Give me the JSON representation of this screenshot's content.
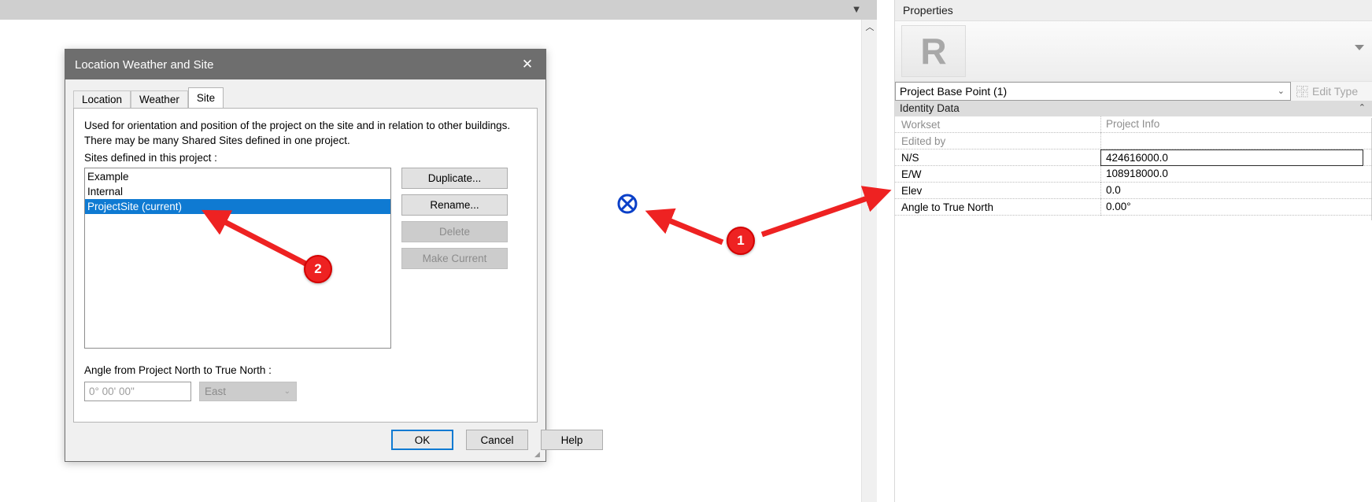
{
  "canvas": {
    "collapse_marker": "▼",
    "scroll_up_arrow": "︿",
    "base_point_name": "project-base-point"
  },
  "annotations": [
    {
      "id": "1",
      "label": "1"
    },
    {
      "id": "2",
      "label": "2"
    }
  ],
  "dialog": {
    "title": "Location Weather and Site",
    "close_glyph": "✕",
    "tabs": [
      {
        "label": "Location",
        "active": false
      },
      {
        "label": "Weather",
        "active": false
      },
      {
        "label": "Site",
        "active": true
      }
    ],
    "description": "Used for orientation and position of the project on the site and in relation to other buildings. There may be many Shared Sites defined in one project.",
    "sites_label": "Sites defined in this project :",
    "sites": [
      {
        "label": "Example",
        "selected": false
      },
      {
        "label": "Internal",
        "selected": false
      },
      {
        "label": "ProjectSite (current)",
        "selected": true
      }
    ],
    "side_buttons": [
      {
        "label": "Duplicate...",
        "disabled": false
      },
      {
        "label": "Rename...",
        "disabled": false
      },
      {
        "label": "Delete",
        "disabled": true
      },
      {
        "label": "Make Current",
        "disabled": true
      }
    ],
    "angle_label": "Angle from Project North to True North :",
    "angle_value": "0° 00' 00\"",
    "angle_direction": "East",
    "angle_direction_chevron": "⌄",
    "footer": {
      "ok": "OK",
      "cancel": "Cancel",
      "help": "Help"
    },
    "resize_grip": "◢"
  },
  "properties": {
    "header_title": "Properties",
    "preview_logo": "R",
    "preview_caret": "caret-down",
    "type_selector": "Project Base Point (1)",
    "type_selector_chevron": "⌄",
    "edit_type_label": "Edit Type",
    "group": {
      "title": "Identity Data",
      "collapse_glyph": "⌃"
    },
    "rows": [
      {
        "name": "Workset",
        "value": "Project Info",
        "readonly": true,
        "active": false
      },
      {
        "name": "Edited by",
        "value": "",
        "readonly": true,
        "active": false
      },
      {
        "name": "N/S",
        "value": "424616000.0",
        "readonly": false,
        "active": true
      },
      {
        "name": "E/W",
        "value": "108918000.0",
        "readonly": false,
        "active": false
      },
      {
        "name": "Elev",
        "value": "0.0",
        "readonly": false,
        "active": false
      },
      {
        "name": "Angle to True North",
        "value": "0.00°",
        "readonly": false,
        "active": false
      }
    ]
  },
  "colors": {
    "accent_blue": "#0f7ad2",
    "annotation_red": "#ee2222",
    "dialog_title_bar": "#6e6e6e",
    "base_point_blue": "#0b40c8"
  }
}
